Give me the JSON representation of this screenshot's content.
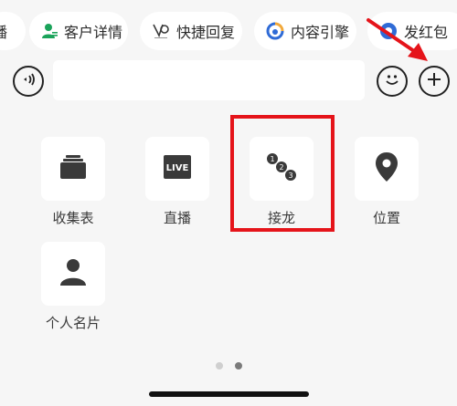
{
  "chips": [
    {
      "label": "播",
      "icon": "partial-icon"
    },
    {
      "label": "客户详情",
      "icon": "person-icon"
    },
    {
      "label": "快捷回复",
      "icon": "quick-reply-icon"
    },
    {
      "label": "内容引擎",
      "icon": "engine-icon"
    },
    {
      "label": "发红包",
      "icon": "red-packet-icon"
    }
  ],
  "input_row": {
    "voice_icon": "voice-icon",
    "emoji_icon": "emoji-icon",
    "plus_icon": "plus-icon"
  },
  "grid": {
    "items": [
      {
        "label": "收集表",
        "icon": "collect-form-icon"
      },
      {
        "label": "直播",
        "icon": "live-icon",
        "badge": "LIVE"
      },
      {
        "label": "接龙",
        "icon": "chain-icon",
        "digits": [
          "1",
          "2",
          "3"
        ]
      },
      {
        "label": "位置",
        "icon": "location-icon"
      },
      {
        "label": "个人名片",
        "icon": "contact-card-icon"
      }
    ]
  },
  "pager": {
    "pages": 2,
    "active_index": 1
  },
  "colors": {
    "background": "#f6f6f6",
    "tile": "#ffffff",
    "icon_dark": "#3a3a3a",
    "highlight": "#e5141a",
    "chip_green": "#1aa35a",
    "chip_blue": "#2f6bd6"
  }
}
